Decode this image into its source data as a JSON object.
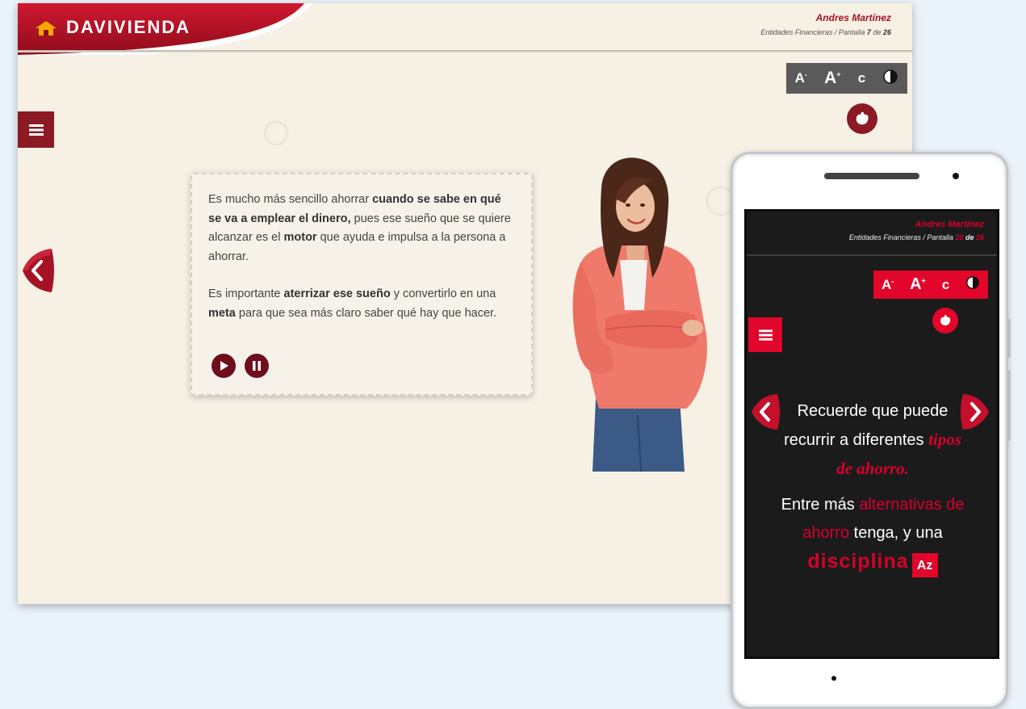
{
  "app": {
    "brand": "DAVIVIENDA",
    "user_name": "Andres Martínez",
    "breadcrumb_prefix": "Entidades Financieras / Pantalla",
    "current_screen": "7",
    "of_label": "de",
    "total_screens": "26"
  },
  "toolbar": {
    "font_decrease": "A",
    "font_increase": "A",
    "reset": "c",
    "minus_sign": "-",
    "plus_sign": "+"
  },
  "content": {
    "p1_a": "Es mucho más sencillo ahorrar ",
    "p1_b": "cuando se sabe en qué se va a emplear el dinero,",
    "p1_c": " pues ese sueño que se quiere alcanzar es el ",
    "p1_d": "motor",
    "p1_e": " que ayuda e impulsa a la persona a ahorrar.",
    "p2_a": "Es importante ",
    "p2_b": "aterrizar ese sueño",
    "p2_c": " y convertirlo en una ",
    "p2_d": "meta",
    "p2_e": " para que sea más claro saber qué hay que hacer."
  },
  "mobile": {
    "user_name": "Andres Martínez",
    "breadcrumb_prefix": "Entidades Financieras / Pantalla",
    "current_screen": "20",
    "of_label": "de",
    "total_screens": "26",
    "t1": "Recuerde que puede recurrir a diferentes ",
    "t1_red": "tipos de ahorro.",
    "t2": "Entre más ",
    "t2_red": "alternativas de ahorro",
    "t3": " tenga, y una ",
    "t4_red": "disciplina",
    "az": "Az"
  },
  "colors": {
    "brand_red": "#a51226",
    "dark_red": "#8b1a24",
    "mobile_red": "#e2062a",
    "cream": "#f6f0e5"
  }
}
